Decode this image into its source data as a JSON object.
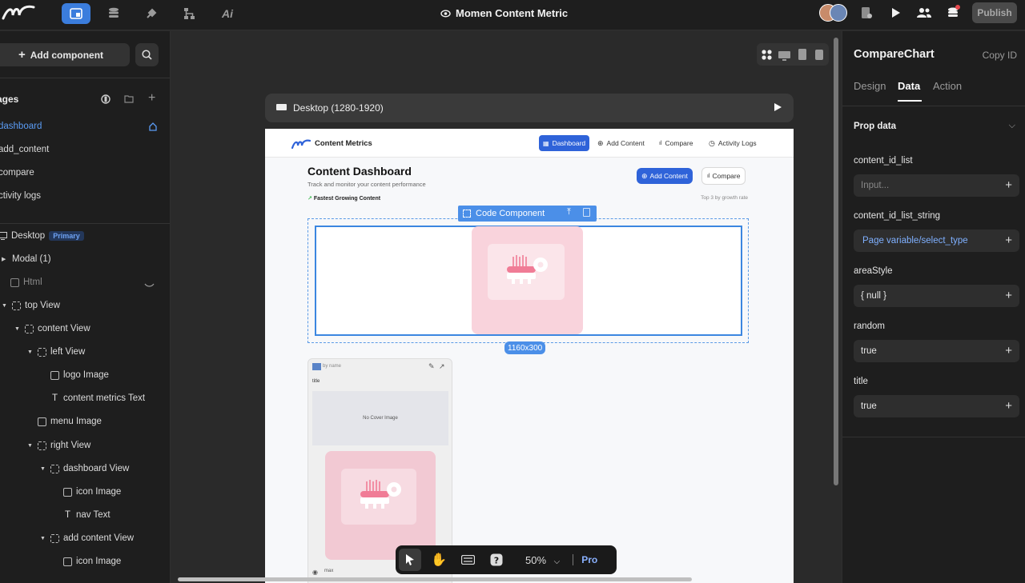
{
  "topbar": {
    "app_title": "Momen Content Metric",
    "publish_label": "Publish"
  },
  "leftpanel": {
    "add_component_label": "Add component",
    "pages_header": "ages",
    "pages": [
      "dashboard",
      "add_content",
      "compare",
      "ctivity logs"
    ],
    "tree": [
      {
        "label": "Desktop",
        "badge": "Primary"
      },
      {
        "label": "Modal (1)"
      },
      {
        "label": "Html"
      },
      {
        "label": "top View"
      },
      {
        "label": "content View"
      },
      {
        "label": "left View"
      },
      {
        "label": "logo Image"
      },
      {
        "label": "content metrics Text"
      },
      {
        "label": "menu Image"
      },
      {
        "label": "right View"
      },
      {
        "label": "dashboard View"
      },
      {
        "label": "icon Image"
      },
      {
        "label": "nav Text"
      },
      {
        "label": "add content View"
      },
      {
        "label": "icon Image"
      }
    ]
  },
  "canvas": {
    "device_label": "Desktop (1280-1920)",
    "frame": {
      "brand": "Content Metrics",
      "nav": [
        "Dashboard",
        "Add Content",
        "Compare",
        "Activity Logs"
      ],
      "title": "Content Dashboard",
      "subtitle": "Track and monitor your content performance",
      "add_button": "Add Content",
      "compare_button": "Compare",
      "fastest_label": "Fastest Growing Content",
      "top3_label": "Top 3 by growth rate",
      "code_component_label": "Code Component",
      "size_label": "1160x300",
      "card": {
        "by_name": "by name",
        "title": "title",
        "no_cover": "No Cover Image",
        "max": "max"
      }
    },
    "zoom_label": "50%",
    "pro_label": "Pro"
  },
  "rightpanel": {
    "component_name": "CompareChart",
    "copy_id_label": "Copy ID",
    "tabs": [
      "Design",
      "Data",
      "Action"
    ],
    "active_tab": "Data",
    "prop_header": "Prop data",
    "props": [
      {
        "label": "content_id_list",
        "value": "Input..."
      },
      {
        "label": "content_id_list_string",
        "value": "Page variable/select_type"
      },
      {
        "label": "areaStyle",
        "value": "{ null }"
      },
      {
        "label": "random",
        "value": "true"
      },
      {
        "label": "title",
        "value": "true"
      }
    ]
  },
  "colors": {
    "accent": "#3b7ddd",
    "selection": "#4b8fe8",
    "placeholder_pink": "#f9d3dc"
  }
}
